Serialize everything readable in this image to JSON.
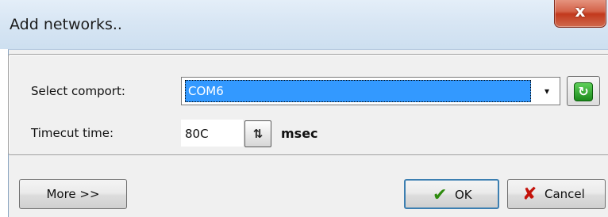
{
  "window": {
    "title": "Add networks..",
    "close_glyph": "x"
  },
  "form": {
    "comport_label": "Select comport:",
    "comport_value": "COM6",
    "dropdown_glyph": "▾",
    "refresh_icon": "refresh-icon",
    "timeout_label": "Timecut time:",
    "timeout_value": "80C",
    "timeout_unit": "msec",
    "spin_glyph": "⇅"
  },
  "buttons": {
    "more_label": "More >>",
    "ok_label": "OK",
    "ok_icon": "check-icon",
    "cancel_label": "Cancel",
    "cancel_icon": "x-icon"
  },
  "colors": {
    "selection": "#3399ff",
    "title_bar": "#d8e6f4",
    "close_button": "#c2391d",
    "ok_check": "#2e8b0e",
    "cancel_x": "#c4120a"
  }
}
